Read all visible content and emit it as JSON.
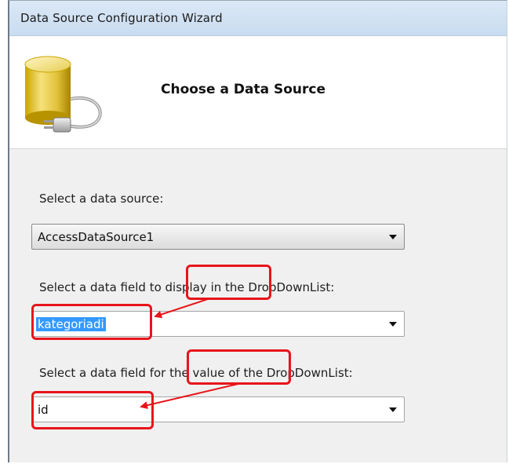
{
  "window": {
    "title": "Data Source Configuration Wizard"
  },
  "header": {
    "heading": "Choose a Data Source",
    "icon": "database-plug-icon"
  },
  "form": {
    "data_source": {
      "label": "Select a data source:",
      "value": "AccessDataSource1"
    },
    "display_field": {
      "label": "Select a data field to display in the DropDownList:",
      "label_pre": "Select a data field ",
      "label_highlight": "to display",
      "label_post": " in the DropDownList:",
      "value": "kategoriadi"
    },
    "value_field": {
      "label": "Select a data field for the value of the DropDownList:",
      "label_pre": "Select a data field ",
      "label_highlight": "for the value",
      "label_post": " of the DropDownList:",
      "value": "id"
    }
  },
  "annotations": {
    "color": "#e8141b"
  }
}
